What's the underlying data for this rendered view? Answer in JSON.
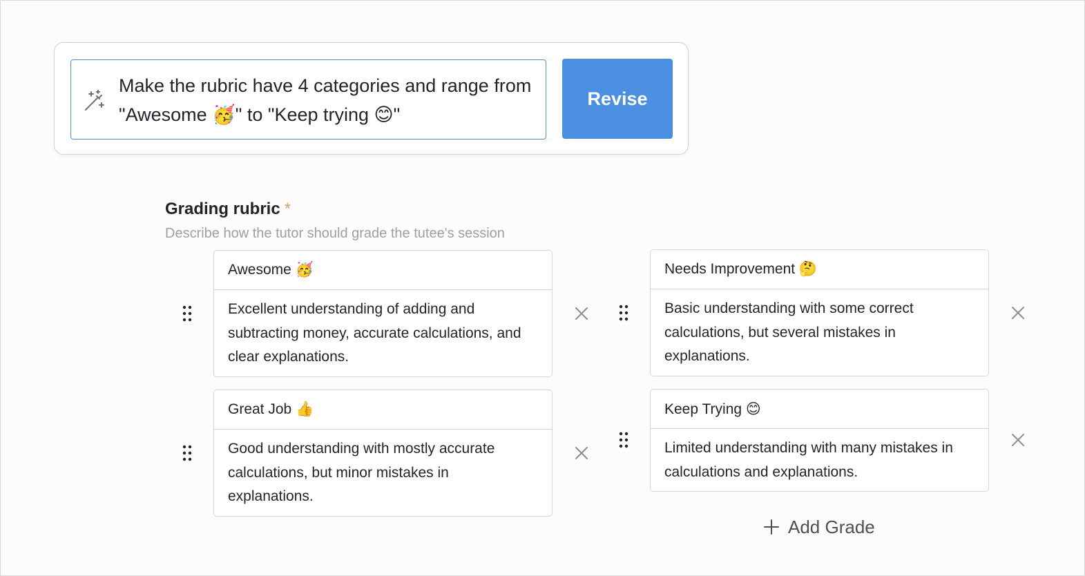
{
  "prompt": {
    "text": "Make the rubric have 4 categories and range from \"Awesome 🥳\" to \"Keep trying 😊\"",
    "icon": "magic-wand-icon",
    "revise_label": "Revise"
  },
  "rubric": {
    "title": "Grading rubric",
    "required_marker": "*",
    "description": "Describe how the tutor should grade the tutee's session",
    "add_label": "Add Grade",
    "grades": [
      {
        "name": "Awesome 🥳",
        "description": "Excellent understanding of adding and subtracting money, accurate calculations, and clear explanations."
      },
      {
        "name": "Great Job 👍",
        "description": "Good understanding with mostly accurate calculations, but minor mistakes in explanations."
      },
      {
        "name": "Needs Improvement 🤔",
        "description": "Basic understanding with some correct calculations, but several mistakes in explanations."
      },
      {
        "name": "Keep Trying 😊",
        "description": "Limited understanding with many mistakes in calculations and explanations."
      }
    ]
  },
  "colors": {
    "accent": "#4a8fe0",
    "required": "#e0a46a",
    "muted_text": "#9aa0a6"
  }
}
